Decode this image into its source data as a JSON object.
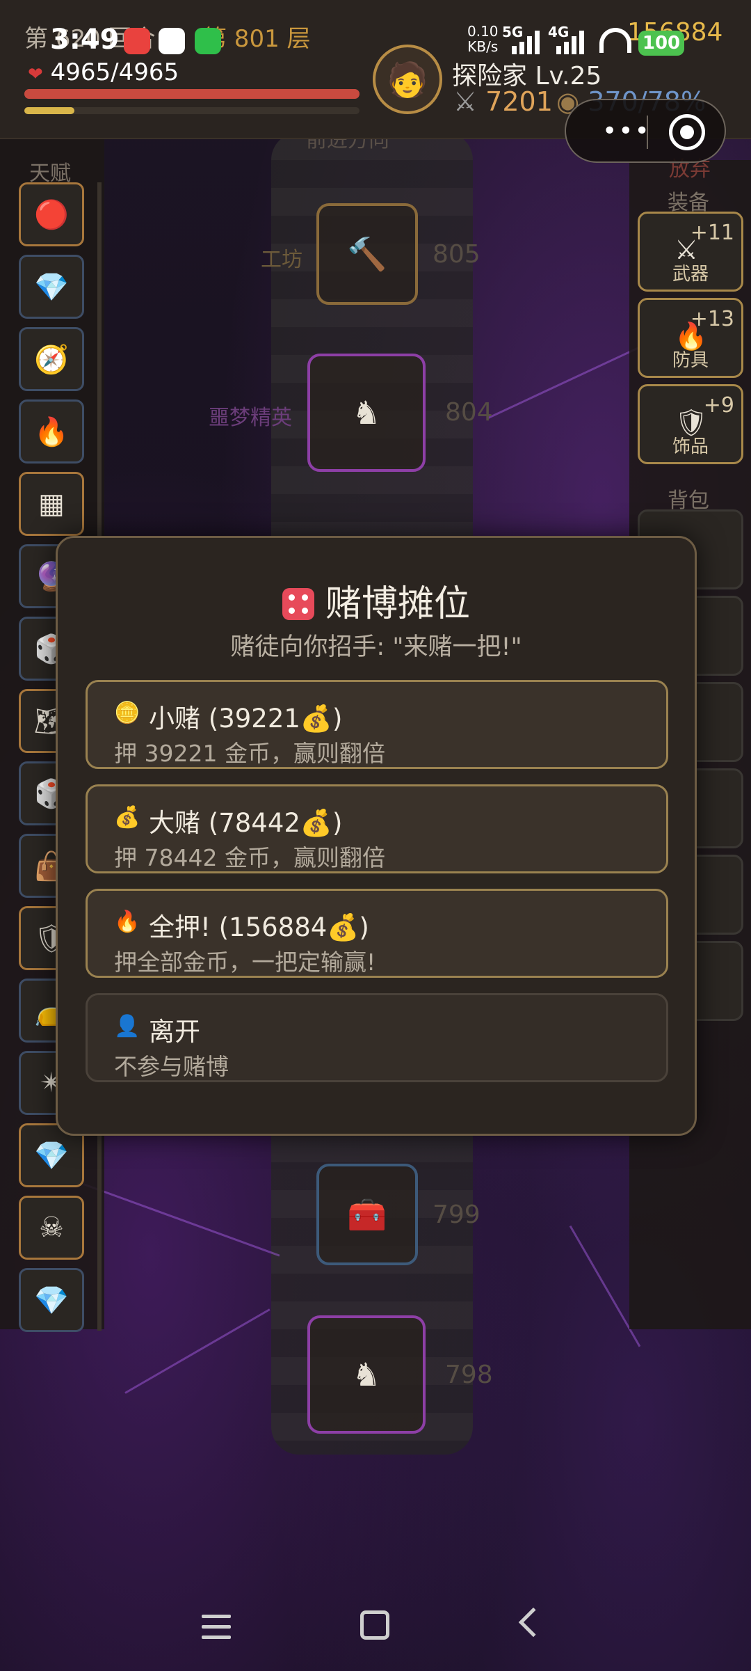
{
  "status_bar": {
    "time": "3:49",
    "net_speed_value": "0.10",
    "net_speed_unit": "KB/s",
    "signal_1": "5G",
    "signal_2": "4G",
    "battery": "100"
  },
  "game_header": {
    "round": "第 620 回合",
    "floor": "第 801 层",
    "gold": "156884",
    "hp": "4965/4965",
    "player_name": "探险家 Lv.25",
    "attack": "7201",
    "defense": "370/78%",
    "hp_fraction": 1.0,
    "xp_fraction": 0.15
  },
  "miniprogram_capsule": {
    "more_icon": "more-dots-icon",
    "close_icon": "target-close-icon"
  },
  "left_panel": {
    "label": "天赋",
    "slots": [
      {
        "icon": "heart-gem-icon",
        "glyph": "🔴",
        "gold": true
      },
      {
        "icon": "diamond-icon",
        "glyph": "💎",
        "gold": false
      },
      {
        "icon": "compass-icon",
        "glyph": "🧭",
        "gold": false
      },
      {
        "icon": "fire-icon",
        "glyph": "🔥",
        "gold": false
      },
      {
        "icon": "grid-scroll-icon",
        "glyph": "▦",
        "gold": true
      },
      {
        "icon": "orb-icon",
        "glyph": "🔮",
        "gold": false
      },
      {
        "icon": "dice-icon",
        "glyph": "🎲",
        "gold": false
      },
      {
        "icon": "map-icon",
        "glyph": "🗺",
        "gold": true
      },
      {
        "icon": "dice-icon",
        "glyph": "🎲",
        "gold": false
      },
      {
        "icon": "bag-icon",
        "glyph": "👜",
        "gold": false
      },
      {
        "icon": "crest-icon",
        "glyph": "🛡",
        "gold": true
      },
      {
        "icon": "bag-icon",
        "glyph": "👝",
        "gold": false
      },
      {
        "icon": "spark-icon",
        "glyph": "✴",
        "gold": false
      },
      {
        "icon": "diamond-icon",
        "glyph": "💎",
        "gold": true
      },
      {
        "icon": "skull-icon",
        "glyph": "☠",
        "gold": true
      },
      {
        "icon": "diamond-icon",
        "glyph": "💎",
        "gold": false
      }
    ]
  },
  "right_panel": {
    "abandon_label": "放弃",
    "equipment_label": "装备",
    "equipment": [
      {
        "name": "武器",
        "plus": "+11",
        "icon": "crossed-swords-icon",
        "glyph": "⚔"
      },
      {
        "name": "防具",
        "plus": "+13",
        "icon": "flame-armor-icon",
        "glyph": "🔥"
      },
      {
        "name": "饰品",
        "plus": "+9",
        "icon": "amulet-icon",
        "glyph": "🛡"
      }
    ],
    "backpack_label": "背包"
  },
  "map": {
    "direction_label": "前进方向",
    "nodes": [
      {
        "name": "工坊",
        "floor": "805",
        "icon": "hammer-icon",
        "glyph": "🔨"
      },
      {
        "name": "噩梦精英",
        "floor": "804",
        "icon": "dark-knight-icon",
        "glyph": "♞"
      },
      {
        "name": "",
        "floor": "799",
        "icon": "treasure-icon",
        "glyph": "🧰"
      },
      {
        "name": "",
        "floor": "798",
        "icon": "dark-knight-icon",
        "glyph": "♞"
      }
    ]
  },
  "modal": {
    "title": "赌博摊位",
    "subtitle": "赌徒向你招手: \"来赌一把!\"",
    "options": [
      {
        "icon": "coin-icon",
        "glyph": "🪙",
        "title": "小赌 (39221💰)",
        "desc": "押 39221 金币，赢则翻倍"
      },
      {
        "icon": "money-bag-icon",
        "glyph": "💰",
        "title": "大赌 (78442💰)",
        "desc": "押 78442 金币，赢则翻倍"
      },
      {
        "icon": "fire-icon",
        "glyph": "🔥",
        "title": "全押! (156884💰)",
        "desc": "押全部金币，一把定输赢!"
      },
      {
        "icon": "ghost-icon",
        "glyph": "👤",
        "title": "离开",
        "desc": "不参与赌博"
      }
    ]
  }
}
